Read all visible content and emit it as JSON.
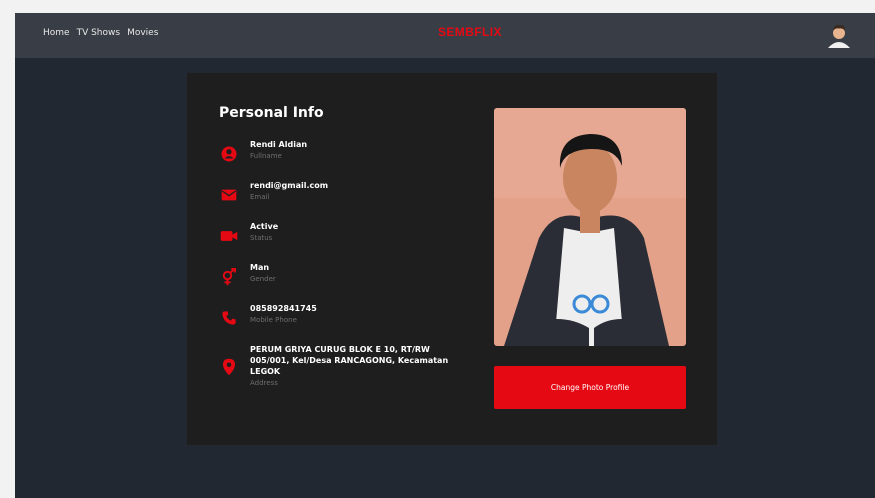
{
  "nav": {
    "links": [
      {
        "label": "Home"
      },
      {
        "label": "TV Shows"
      },
      {
        "label": "Movies"
      }
    ],
    "brand": "SEMBFLIX",
    "avatar_icon": "user-avatar"
  },
  "profile": {
    "title": "Personal Info",
    "items": [
      {
        "icon": "user-circle-icon",
        "value": "Rendi Aldian",
        "label": "Fullname"
      },
      {
        "icon": "envelope-icon",
        "value": "rendi@gmail.com",
        "label": "Email"
      },
      {
        "icon": "video-camera-icon",
        "value": "Active",
        "label": "Status"
      },
      {
        "icon": "gender-icon",
        "value": "Man",
        "label": "Gender"
      },
      {
        "icon": "phone-icon",
        "value": "085892841745",
        "label": "Mobile Phone"
      },
      {
        "icon": "map-pin-icon",
        "value": "PERUM GRIYA CURUG BLOK E 10, RT/RW 005/001, Kel/Desa RANCAGONG, Kecamatan LEGOK",
        "label": "Address"
      }
    ],
    "button_label": "Change Photo Profile"
  },
  "colors": {
    "accent": "#e50914",
    "background": "#222831",
    "navbar": "#393e46",
    "card": "#1e1e1e"
  }
}
